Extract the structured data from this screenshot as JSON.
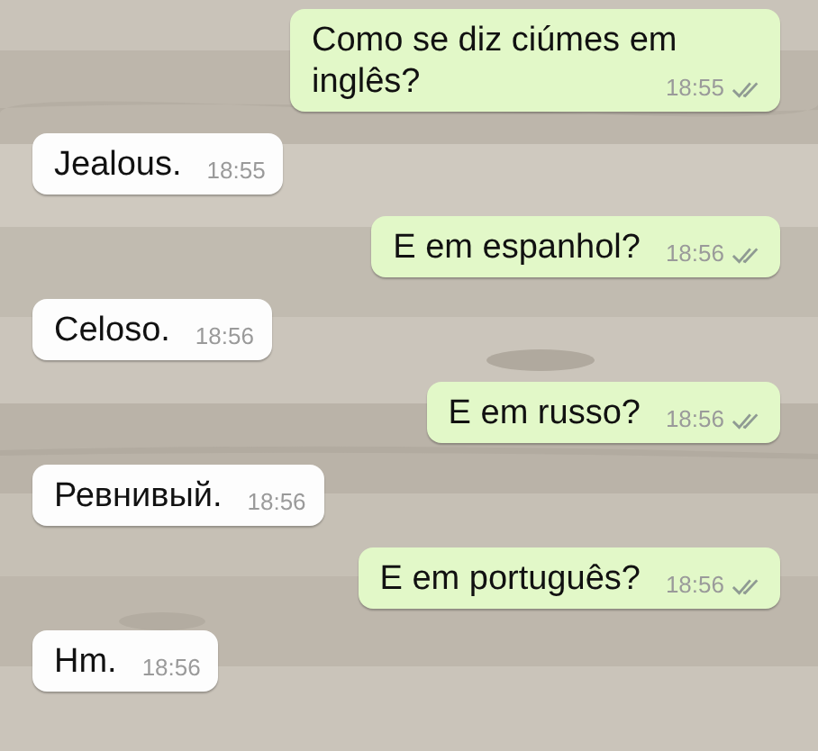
{
  "messages": [
    {
      "kind": "outgoing",
      "text": "Como se diz ciúmes em inglês?",
      "time": "18:55",
      "read": true
    },
    {
      "kind": "incoming",
      "text": "Jealous.",
      "time": "18:55"
    },
    {
      "kind": "outgoing",
      "text": "E em espanhol?",
      "time": "18:56",
      "read": true
    },
    {
      "kind": "incoming",
      "text": "Celoso.",
      "time": "18:56"
    },
    {
      "kind": "outgoing",
      "text": "E em russo?",
      "time": "18:56",
      "read": true
    },
    {
      "kind": "incoming",
      "text": "Ревнивый.",
      "time": "18:56"
    },
    {
      "kind": "outgoing",
      "text": "E em português?",
      "time": "18:56",
      "read": true
    },
    {
      "kind": "incoming",
      "text": "Hm.",
      "time": "18:56"
    }
  ]
}
